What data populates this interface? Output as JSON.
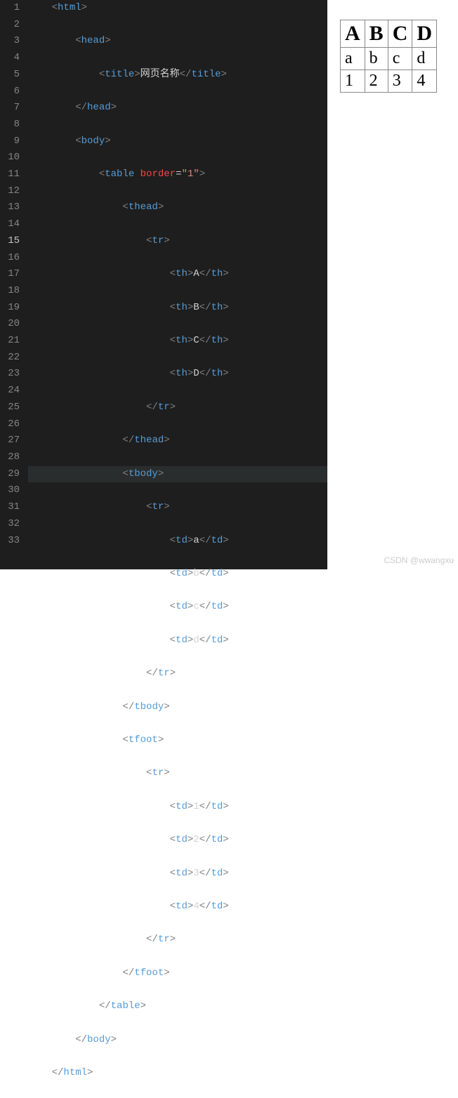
{
  "editor": {
    "activeLine": 15,
    "lines": [
      {
        "n": 1,
        "indent": 1,
        "parts": [
          {
            "t": "bracket",
            "v": "<"
          },
          {
            "t": "tag",
            "v": "html"
          },
          {
            "t": "bracket",
            "v": ">"
          }
        ]
      },
      {
        "n": 2,
        "indent": 2,
        "parts": [
          {
            "t": "bracket",
            "v": "<"
          },
          {
            "t": "tag",
            "v": "head"
          },
          {
            "t": "bracket",
            "v": ">"
          }
        ]
      },
      {
        "n": 3,
        "indent": 3,
        "parts": [
          {
            "t": "bracket",
            "v": "<"
          },
          {
            "t": "tag",
            "v": "title"
          },
          {
            "t": "bracket",
            "v": ">"
          },
          {
            "t": "text",
            "v": "网页名称"
          },
          {
            "t": "bracket",
            "v": "</"
          },
          {
            "t": "tag",
            "v": "title"
          },
          {
            "t": "bracket",
            "v": ">"
          }
        ]
      },
      {
        "n": 4,
        "indent": 2,
        "parts": [
          {
            "t": "bracket",
            "v": "</"
          },
          {
            "t": "tag",
            "v": "head"
          },
          {
            "t": "bracket",
            "v": ">"
          }
        ]
      },
      {
        "n": 5,
        "indent": 2,
        "parts": [
          {
            "t": "bracket",
            "v": "<"
          },
          {
            "t": "tag",
            "v": "body"
          },
          {
            "t": "bracket",
            "v": ">"
          }
        ]
      },
      {
        "n": 6,
        "indent": 3,
        "parts": [
          {
            "t": "bracket",
            "v": "<"
          },
          {
            "t": "tag",
            "v": "table"
          },
          {
            "t": "text",
            "v": " "
          },
          {
            "t": "attr-border",
            "v": "border"
          },
          {
            "t": "text",
            "v": "="
          },
          {
            "t": "string",
            "v": "\"1\""
          },
          {
            "t": "bracket",
            "v": ">"
          }
        ]
      },
      {
        "n": 7,
        "indent": 4,
        "parts": [
          {
            "t": "bracket",
            "v": "<"
          },
          {
            "t": "tag",
            "v": "thead"
          },
          {
            "t": "bracket",
            "v": ">"
          }
        ]
      },
      {
        "n": 8,
        "indent": 5,
        "parts": [
          {
            "t": "bracket",
            "v": "<"
          },
          {
            "t": "tag",
            "v": "tr"
          },
          {
            "t": "bracket",
            "v": ">"
          }
        ]
      },
      {
        "n": 9,
        "indent": 6,
        "parts": [
          {
            "t": "bracket",
            "v": "<"
          },
          {
            "t": "tag",
            "v": "th"
          },
          {
            "t": "bracket",
            "v": ">"
          },
          {
            "t": "text",
            "v": "A"
          },
          {
            "t": "bracket",
            "v": "</"
          },
          {
            "t": "tag",
            "v": "th"
          },
          {
            "t": "bracket",
            "v": ">"
          }
        ]
      },
      {
        "n": 10,
        "indent": 6,
        "parts": [
          {
            "t": "bracket",
            "v": "<"
          },
          {
            "t": "tag",
            "v": "th"
          },
          {
            "t": "bracket",
            "v": ">"
          },
          {
            "t": "text",
            "v": "B"
          },
          {
            "t": "bracket",
            "v": "</"
          },
          {
            "t": "tag",
            "v": "th"
          },
          {
            "t": "bracket",
            "v": ">"
          }
        ]
      },
      {
        "n": 11,
        "indent": 6,
        "parts": [
          {
            "t": "bracket",
            "v": "<"
          },
          {
            "t": "tag",
            "v": "th"
          },
          {
            "t": "bracket",
            "v": ">"
          },
          {
            "t": "text",
            "v": "C"
          },
          {
            "t": "bracket",
            "v": "</"
          },
          {
            "t": "tag",
            "v": "th"
          },
          {
            "t": "bracket",
            "v": ">"
          }
        ]
      },
      {
        "n": 12,
        "indent": 6,
        "parts": [
          {
            "t": "bracket",
            "v": "<"
          },
          {
            "t": "tag",
            "v": "th"
          },
          {
            "t": "bracket",
            "v": ">"
          },
          {
            "t": "text",
            "v": "D"
          },
          {
            "t": "bracket",
            "v": "</"
          },
          {
            "t": "tag",
            "v": "th"
          },
          {
            "t": "bracket",
            "v": ">"
          }
        ]
      },
      {
        "n": 13,
        "indent": 5,
        "parts": [
          {
            "t": "bracket",
            "v": "</"
          },
          {
            "t": "tag",
            "v": "tr"
          },
          {
            "t": "bracket",
            "v": ">"
          }
        ]
      },
      {
        "n": 14,
        "indent": 4,
        "parts": [
          {
            "t": "bracket",
            "v": "</"
          },
          {
            "t": "tag",
            "v": "thead"
          },
          {
            "t": "bracket",
            "v": ">"
          }
        ]
      },
      {
        "n": 15,
        "indent": 4,
        "parts": [
          {
            "t": "bracket",
            "v": "<"
          },
          {
            "t": "tag",
            "v": "tbody"
          },
          {
            "t": "bracket",
            "v": ">"
          }
        ]
      },
      {
        "n": 16,
        "indent": 5,
        "parts": [
          {
            "t": "bracket",
            "v": "<"
          },
          {
            "t": "tag",
            "v": "tr"
          },
          {
            "t": "bracket",
            "v": ">"
          }
        ]
      },
      {
        "n": 17,
        "indent": 6,
        "parts": [
          {
            "t": "bracket",
            "v": "<"
          },
          {
            "t": "tag",
            "v": "td"
          },
          {
            "t": "bracket",
            "v": ">"
          },
          {
            "t": "text",
            "v": "a"
          },
          {
            "t": "bracket",
            "v": "</"
          },
          {
            "t": "tag",
            "v": "td"
          },
          {
            "t": "bracket",
            "v": ">"
          }
        ]
      },
      {
        "n": 18,
        "indent": 6,
        "parts": [
          {
            "t": "bracket",
            "v": "<"
          },
          {
            "t": "tag",
            "v": "td"
          },
          {
            "t": "bracket",
            "v": ">"
          },
          {
            "t": "text",
            "v": "b"
          },
          {
            "t": "bracket",
            "v": "</"
          },
          {
            "t": "tag",
            "v": "td"
          },
          {
            "t": "bracket",
            "v": ">"
          }
        ]
      },
      {
        "n": 19,
        "indent": 6,
        "parts": [
          {
            "t": "bracket",
            "v": "<"
          },
          {
            "t": "tag",
            "v": "td"
          },
          {
            "t": "bracket",
            "v": ">"
          },
          {
            "t": "text",
            "v": "c"
          },
          {
            "t": "bracket",
            "v": "</"
          },
          {
            "t": "tag",
            "v": "td"
          },
          {
            "t": "bracket",
            "v": ">"
          }
        ]
      },
      {
        "n": 20,
        "indent": 6,
        "parts": [
          {
            "t": "bracket",
            "v": "<"
          },
          {
            "t": "tag",
            "v": "td"
          },
          {
            "t": "bracket",
            "v": ">"
          },
          {
            "t": "text",
            "v": "d"
          },
          {
            "t": "bracket",
            "v": "</"
          },
          {
            "t": "tag",
            "v": "td"
          },
          {
            "t": "bracket",
            "v": ">"
          }
        ]
      },
      {
        "n": 21,
        "indent": 5,
        "parts": [
          {
            "t": "bracket",
            "v": "</"
          },
          {
            "t": "tag",
            "v": "tr"
          },
          {
            "t": "bracket",
            "v": ">"
          }
        ]
      },
      {
        "n": 22,
        "indent": 4,
        "parts": [
          {
            "t": "bracket",
            "v": "</"
          },
          {
            "t": "tag",
            "v": "tbody"
          },
          {
            "t": "bracket",
            "v": ">"
          }
        ]
      },
      {
        "n": 23,
        "indent": 4,
        "parts": [
          {
            "t": "bracket",
            "v": "<"
          },
          {
            "t": "tag",
            "v": "tfoot"
          },
          {
            "t": "bracket",
            "v": ">"
          }
        ]
      },
      {
        "n": 24,
        "indent": 5,
        "parts": [
          {
            "t": "bracket",
            "v": "<"
          },
          {
            "t": "tag",
            "v": "tr"
          },
          {
            "t": "bracket",
            "v": ">"
          }
        ]
      },
      {
        "n": 25,
        "indent": 6,
        "parts": [
          {
            "t": "bracket",
            "v": "<"
          },
          {
            "t": "tag",
            "v": "td"
          },
          {
            "t": "bracket",
            "v": ">"
          },
          {
            "t": "text",
            "v": "1"
          },
          {
            "t": "bracket",
            "v": "</"
          },
          {
            "t": "tag",
            "v": "td"
          },
          {
            "t": "bracket",
            "v": ">"
          }
        ]
      },
      {
        "n": 26,
        "indent": 6,
        "parts": [
          {
            "t": "bracket",
            "v": "<"
          },
          {
            "t": "tag",
            "v": "td"
          },
          {
            "t": "bracket",
            "v": ">"
          },
          {
            "t": "text",
            "v": "2"
          },
          {
            "t": "bracket",
            "v": "</"
          },
          {
            "t": "tag",
            "v": "td"
          },
          {
            "t": "bracket",
            "v": ">"
          }
        ]
      },
      {
        "n": 27,
        "indent": 6,
        "parts": [
          {
            "t": "bracket",
            "v": "<"
          },
          {
            "t": "tag",
            "v": "td"
          },
          {
            "t": "bracket",
            "v": ">"
          },
          {
            "t": "text",
            "v": "3"
          },
          {
            "t": "bracket",
            "v": "</"
          },
          {
            "t": "tag",
            "v": "td"
          },
          {
            "t": "bracket",
            "v": ">"
          }
        ]
      },
      {
        "n": 28,
        "indent": 6,
        "parts": [
          {
            "t": "bracket",
            "v": "<"
          },
          {
            "t": "tag",
            "v": "td"
          },
          {
            "t": "bracket",
            "v": ">"
          },
          {
            "t": "text",
            "v": "4"
          },
          {
            "t": "bracket",
            "v": "</"
          },
          {
            "t": "tag",
            "v": "td"
          },
          {
            "t": "bracket",
            "v": ">"
          }
        ]
      },
      {
        "n": 29,
        "indent": 5,
        "parts": [
          {
            "t": "bracket",
            "v": "</"
          },
          {
            "t": "tag",
            "v": "tr"
          },
          {
            "t": "bracket",
            "v": ">"
          }
        ]
      },
      {
        "n": 30,
        "indent": 4,
        "parts": [
          {
            "t": "bracket",
            "v": "</"
          },
          {
            "t": "tag",
            "v": "tfoot"
          },
          {
            "t": "bracket",
            "v": ">"
          }
        ]
      },
      {
        "n": 31,
        "indent": 3,
        "parts": [
          {
            "t": "bracket",
            "v": "</"
          },
          {
            "t": "tag",
            "v": "table"
          },
          {
            "t": "bracket",
            "v": ">"
          }
        ]
      },
      {
        "n": 32,
        "indent": 2,
        "parts": [
          {
            "t": "bracket",
            "v": "</"
          },
          {
            "t": "tag",
            "v": "body"
          },
          {
            "t": "bracket",
            "v": ">"
          }
        ]
      },
      {
        "n": 33,
        "indent": 1,
        "parts": [
          {
            "t": "bracket",
            "v": "</"
          },
          {
            "t": "tag",
            "v": "html"
          },
          {
            "t": "bracket",
            "v": ">"
          }
        ]
      }
    ]
  },
  "preview": {
    "thead": [
      "A",
      "B",
      "C",
      "D"
    ],
    "tbody": [
      "a",
      "b",
      "c",
      "d"
    ],
    "tfoot": [
      "1",
      "2",
      "3",
      "4"
    ]
  },
  "watermark": "CSDN @wwangxu"
}
